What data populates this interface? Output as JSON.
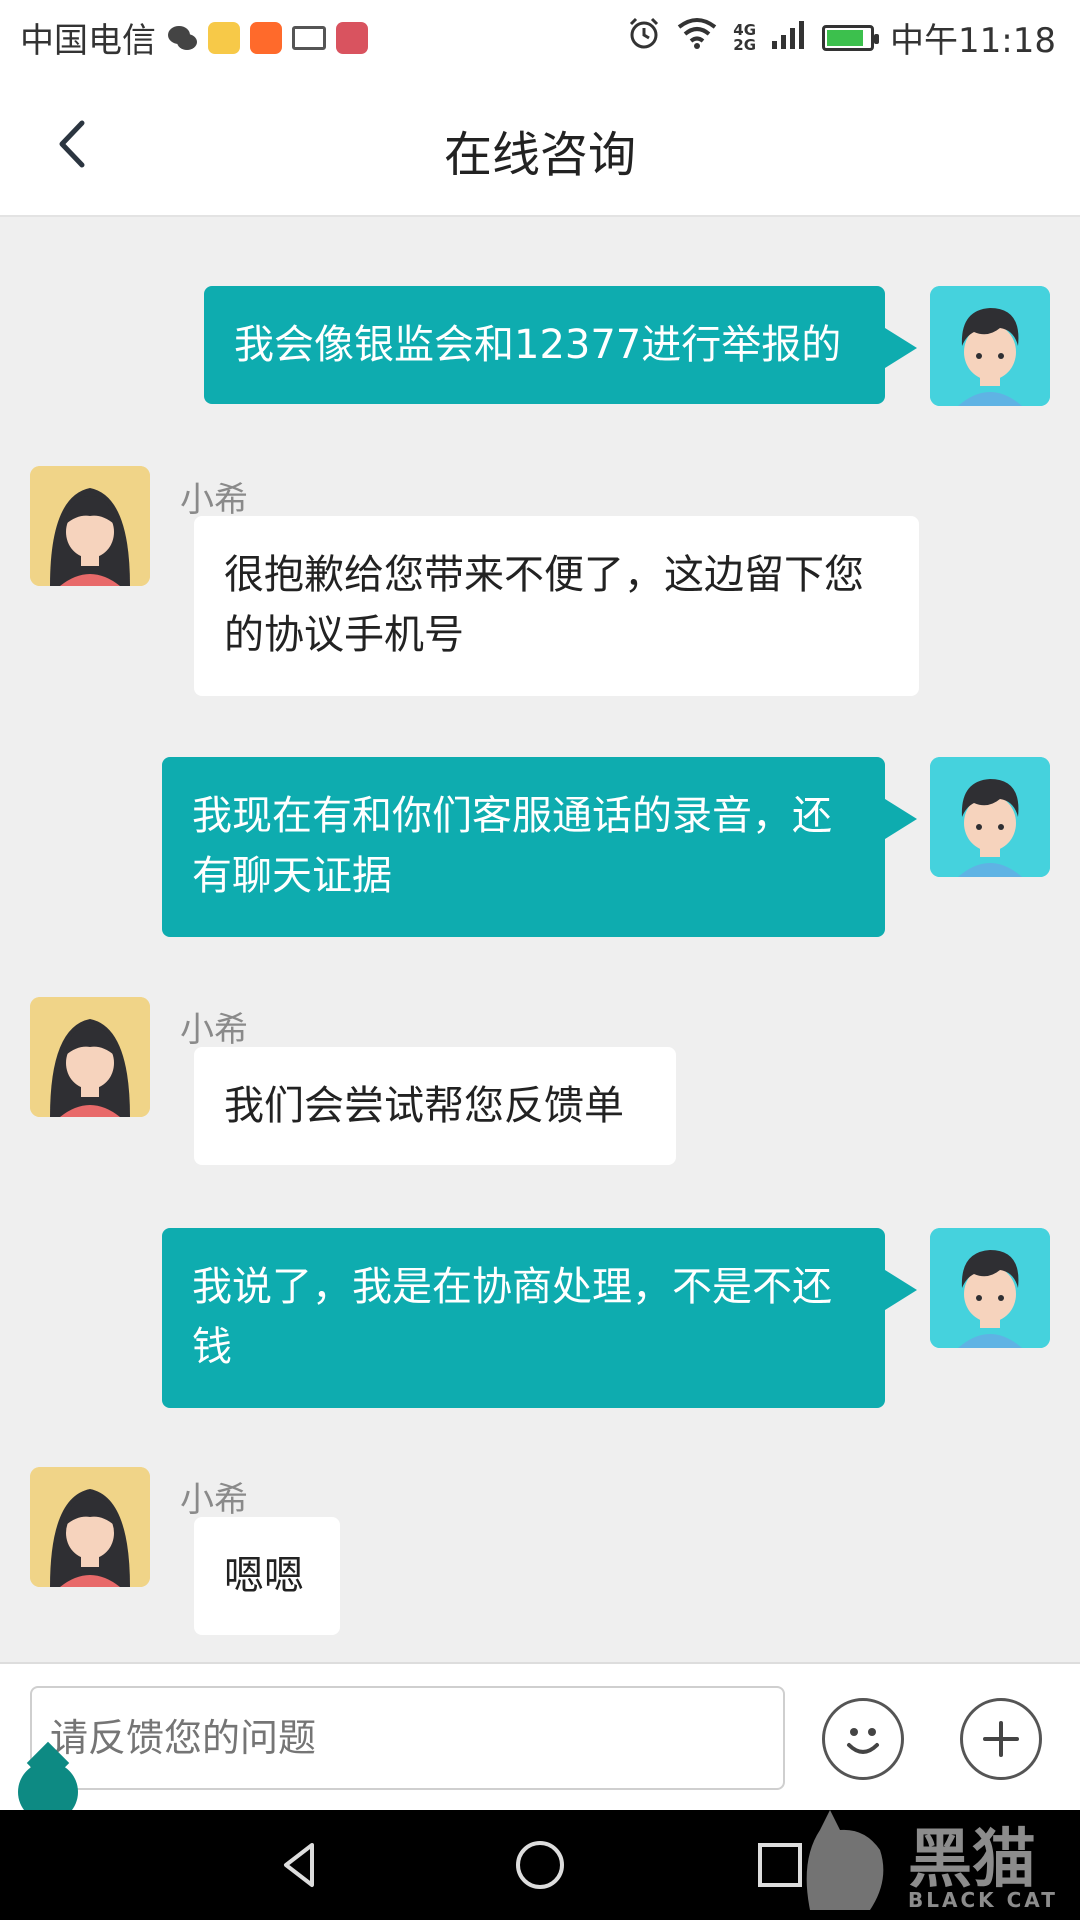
{
  "status_bar": {
    "carrier": "中国电信",
    "network_top": "4G",
    "network_bottom": "2G",
    "time": "中午11:18"
  },
  "header": {
    "title": "在线咨询"
  },
  "messages": [
    {
      "sender": "user",
      "text": "我会像银监会和12377进行举报的"
    },
    {
      "sender": "agent",
      "name": "小希",
      "text": "很抱歉给您带来不便了，这边留下您的协议手机号"
    },
    {
      "sender": "user",
      "text": "我现在有和你们客服通话的录音，还有聊天证据"
    },
    {
      "sender": "agent",
      "name": "小希",
      "text": "我们会尝试帮您反馈单"
    },
    {
      "sender": "user",
      "text": "我说了，我是在协商处理，不是不还钱"
    },
    {
      "sender": "agent",
      "name": "小希",
      "text": "嗯嗯"
    }
  ],
  "input": {
    "placeholder": "请反馈您的问题"
  },
  "watermark": {
    "main": "黑猫",
    "sub": "BLACK CAT"
  },
  "colors": {
    "user_bubble": "#0eacaf",
    "agent_bubble": "#ffffff",
    "chat_background": "#efefef",
    "user_avatar_bg": "#45d2dd",
    "agent_avatar_bg": "#f0d488"
  }
}
